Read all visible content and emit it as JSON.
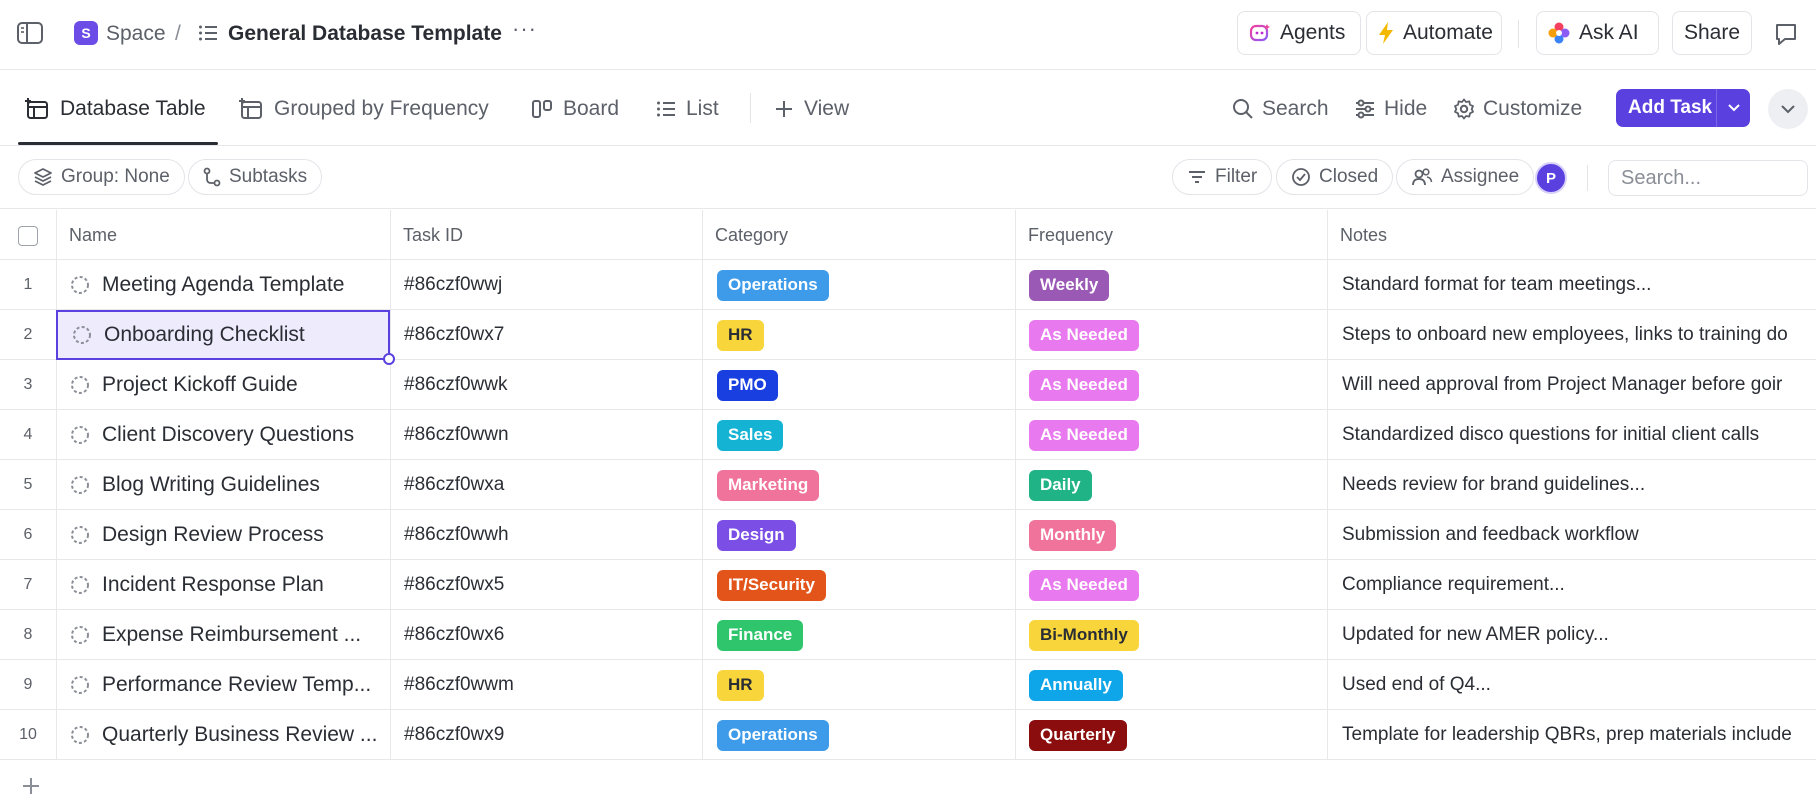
{
  "breadcrumb": {
    "space_badge": "S",
    "space": "Space",
    "separator": "/",
    "title": "General Database Template",
    "more": "···"
  },
  "topbar": {
    "agents": "Agents",
    "automate": "Automate",
    "ask_ai": "Ask AI",
    "share": "Share"
  },
  "views": {
    "tabs": [
      {
        "label": "Database Table",
        "icon": "table-add-icon",
        "active": true
      },
      {
        "label": "Grouped by Frequency",
        "icon": "table-add-icon",
        "active": false
      },
      {
        "label": "Board",
        "icon": "board-icon",
        "active": false
      },
      {
        "label": "List",
        "icon": "list-icon",
        "active": false
      },
      {
        "label": "View",
        "icon": "plus-icon",
        "active": false
      }
    ],
    "search": "Search",
    "hide": "Hide",
    "customize": "Customize",
    "add_task": "Add Task"
  },
  "filters": {
    "group": "Group: None",
    "subtasks": "Subtasks",
    "filter": "Filter",
    "closed": "Closed",
    "assignee": "Assignee",
    "avatar_initial": "P",
    "search_placeholder": "Search..."
  },
  "table": {
    "columns": [
      "Name",
      "Task ID",
      "Category",
      "Frequency",
      "Notes"
    ],
    "rows": [
      {
        "num": "1",
        "name": "Meeting Agenda Template",
        "task_id": "#86czf0wwj",
        "category": "Operations",
        "frequency": "Weekly",
        "notes": "Standard format for team meetings..."
      },
      {
        "num": "2",
        "name": "Onboarding Checklist",
        "task_id": "#86czf0wx7",
        "category": "HR",
        "frequency": "As Needed",
        "notes": "Steps to onboard new employees, links to training do"
      },
      {
        "num": "3",
        "name": "Project Kickoff Guide",
        "task_id": "#86czf0wwk",
        "category": "PMO",
        "frequency": "As Needed",
        "notes": "Will need approval from Project Manager before goir"
      },
      {
        "num": "4",
        "name": "Client Discovery Questions",
        "task_id": "#86czf0wwn",
        "category": "Sales",
        "frequency": "As Needed",
        "notes": "Standardized disco questions for initial client calls"
      },
      {
        "num": "5",
        "name": "Blog Writing Guidelines",
        "task_id": "#86czf0wxa",
        "category": "Marketing",
        "frequency": "Daily",
        "notes": "Needs review for brand guidelines..."
      },
      {
        "num": "6",
        "name": "Design Review Process",
        "task_id": "#86czf0wwh",
        "category": "Design",
        "frequency": "Monthly",
        "notes": "Submission and feedback workflow"
      },
      {
        "num": "7",
        "name": "Incident Response Plan",
        "task_id": "#86czf0wx5",
        "category": "IT/Security",
        "frequency": "As Needed",
        "notes": "Compliance requirement..."
      },
      {
        "num": "8",
        "name": "Expense Reimbursement ...",
        "task_id": "#86czf0wx6",
        "category": "Finance",
        "frequency": "Bi-Monthly",
        "notes": "Updated for new AMER policy..."
      },
      {
        "num": "9",
        "name": "Performance Review Temp...",
        "task_id": "#86czf0wwm",
        "category": "HR",
        "frequency": "Annually",
        "notes": "Used end of Q4..."
      },
      {
        "num": "10",
        "name": "Quarterly Business Review ...",
        "task_id": "#86czf0wx9",
        "category": "Operations",
        "frequency": "Quarterly",
        "notes": "Template for leadership QBRs, prep materials include"
      }
    ],
    "selected_row": 1
  },
  "colors": {
    "accent": "#5b40e0",
    "categories": {
      "Operations": "#3d9be9",
      "HR": "#f8d53a",
      "PMO": "#1a3fe0",
      "Sales": "#14b3d4",
      "Marketing": "#f0739c",
      "Design": "#7b4fe6",
      "IT/Security": "#e2541a",
      "Finance": "#2ec56d"
    },
    "frequencies": {
      "Weekly": "#9b59b6",
      "As Needed": "#e879ee",
      "Daily": "#1fb386",
      "Monthly": "#f0739c",
      "Bi-Monthly": "#f8d53a",
      "Annually": "#0ea5e9",
      "Quarterly": "#8b0d0d"
    }
  }
}
